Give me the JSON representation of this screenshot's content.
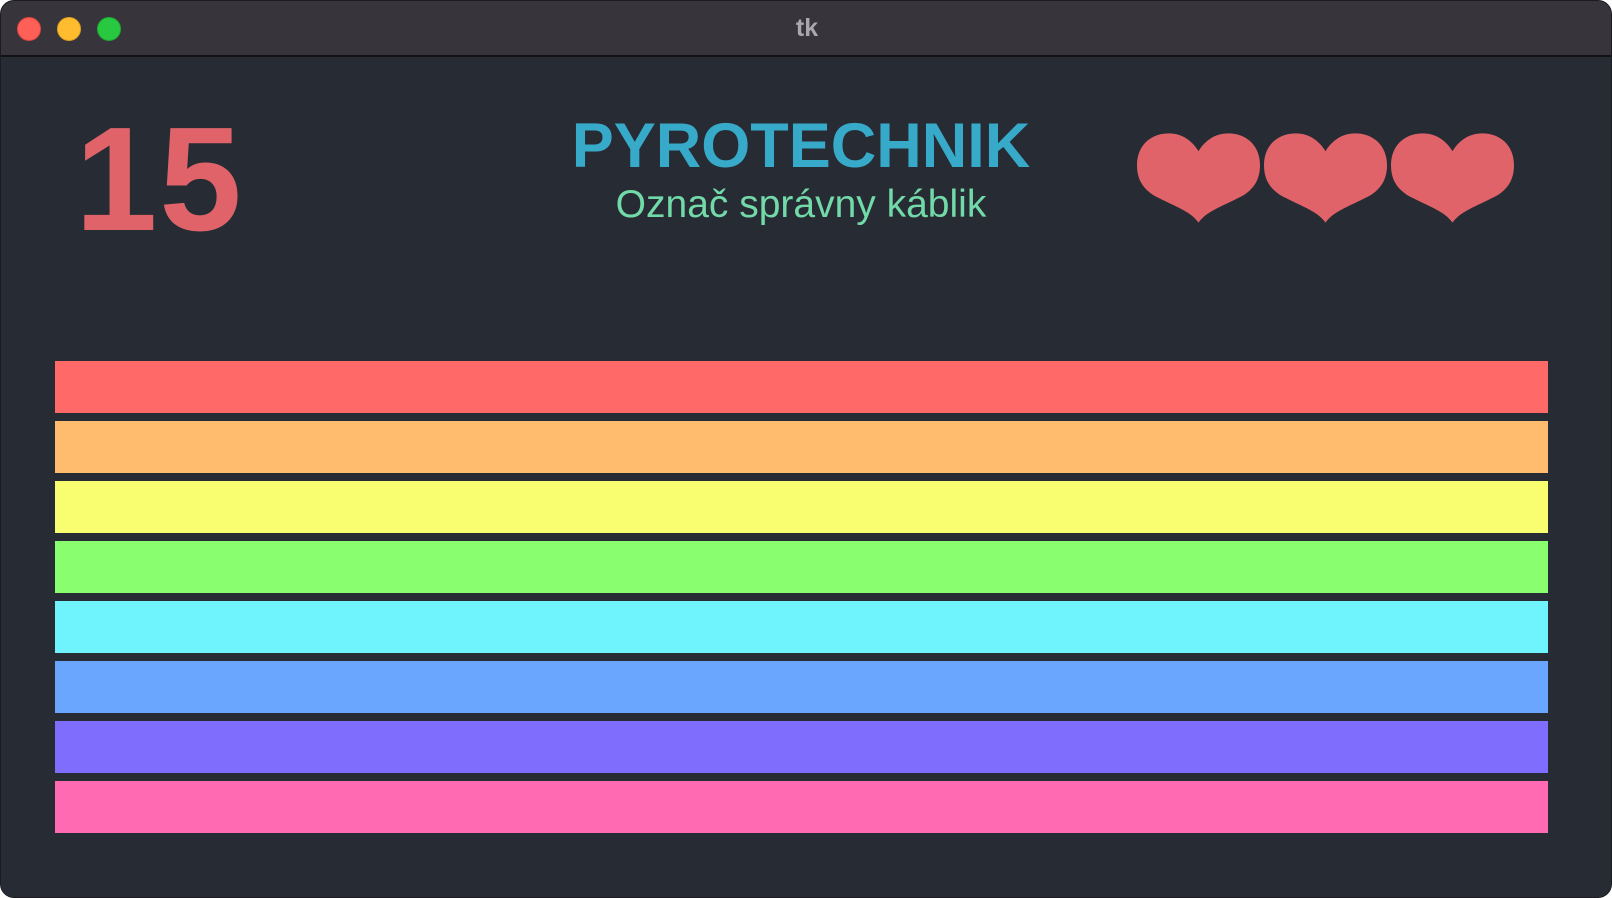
{
  "window": {
    "title": "tk",
    "buttons": [
      "close",
      "minimize",
      "zoom"
    ]
  },
  "game": {
    "timer": "15",
    "title": "PYROTECHNIK",
    "subtitle": "Označ správny káblik",
    "lives": 3,
    "colors": {
      "background": "#272b34",
      "timer": "#e0636a",
      "title": "#37aac9",
      "subtitle": "#72d9a8",
      "heart": "#e0636a"
    }
  },
  "wires": [
    {
      "name": "red",
      "color": "#ff6a69"
    },
    {
      "name": "orange",
      "color": "#ffbb6e"
    },
    {
      "name": "yellow",
      "color": "#f9fe70"
    },
    {
      "name": "green",
      "color": "#89fe6e"
    },
    {
      "name": "cyan",
      "color": "#6ff4fd"
    },
    {
      "name": "blue",
      "color": "#6aa6fd"
    },
    {
      "name": "purple",
      "color": "#7f6dfd"
    },
    {
      "name": "pink",
      "color": "#ff6ab2"
    }
  ]
}
